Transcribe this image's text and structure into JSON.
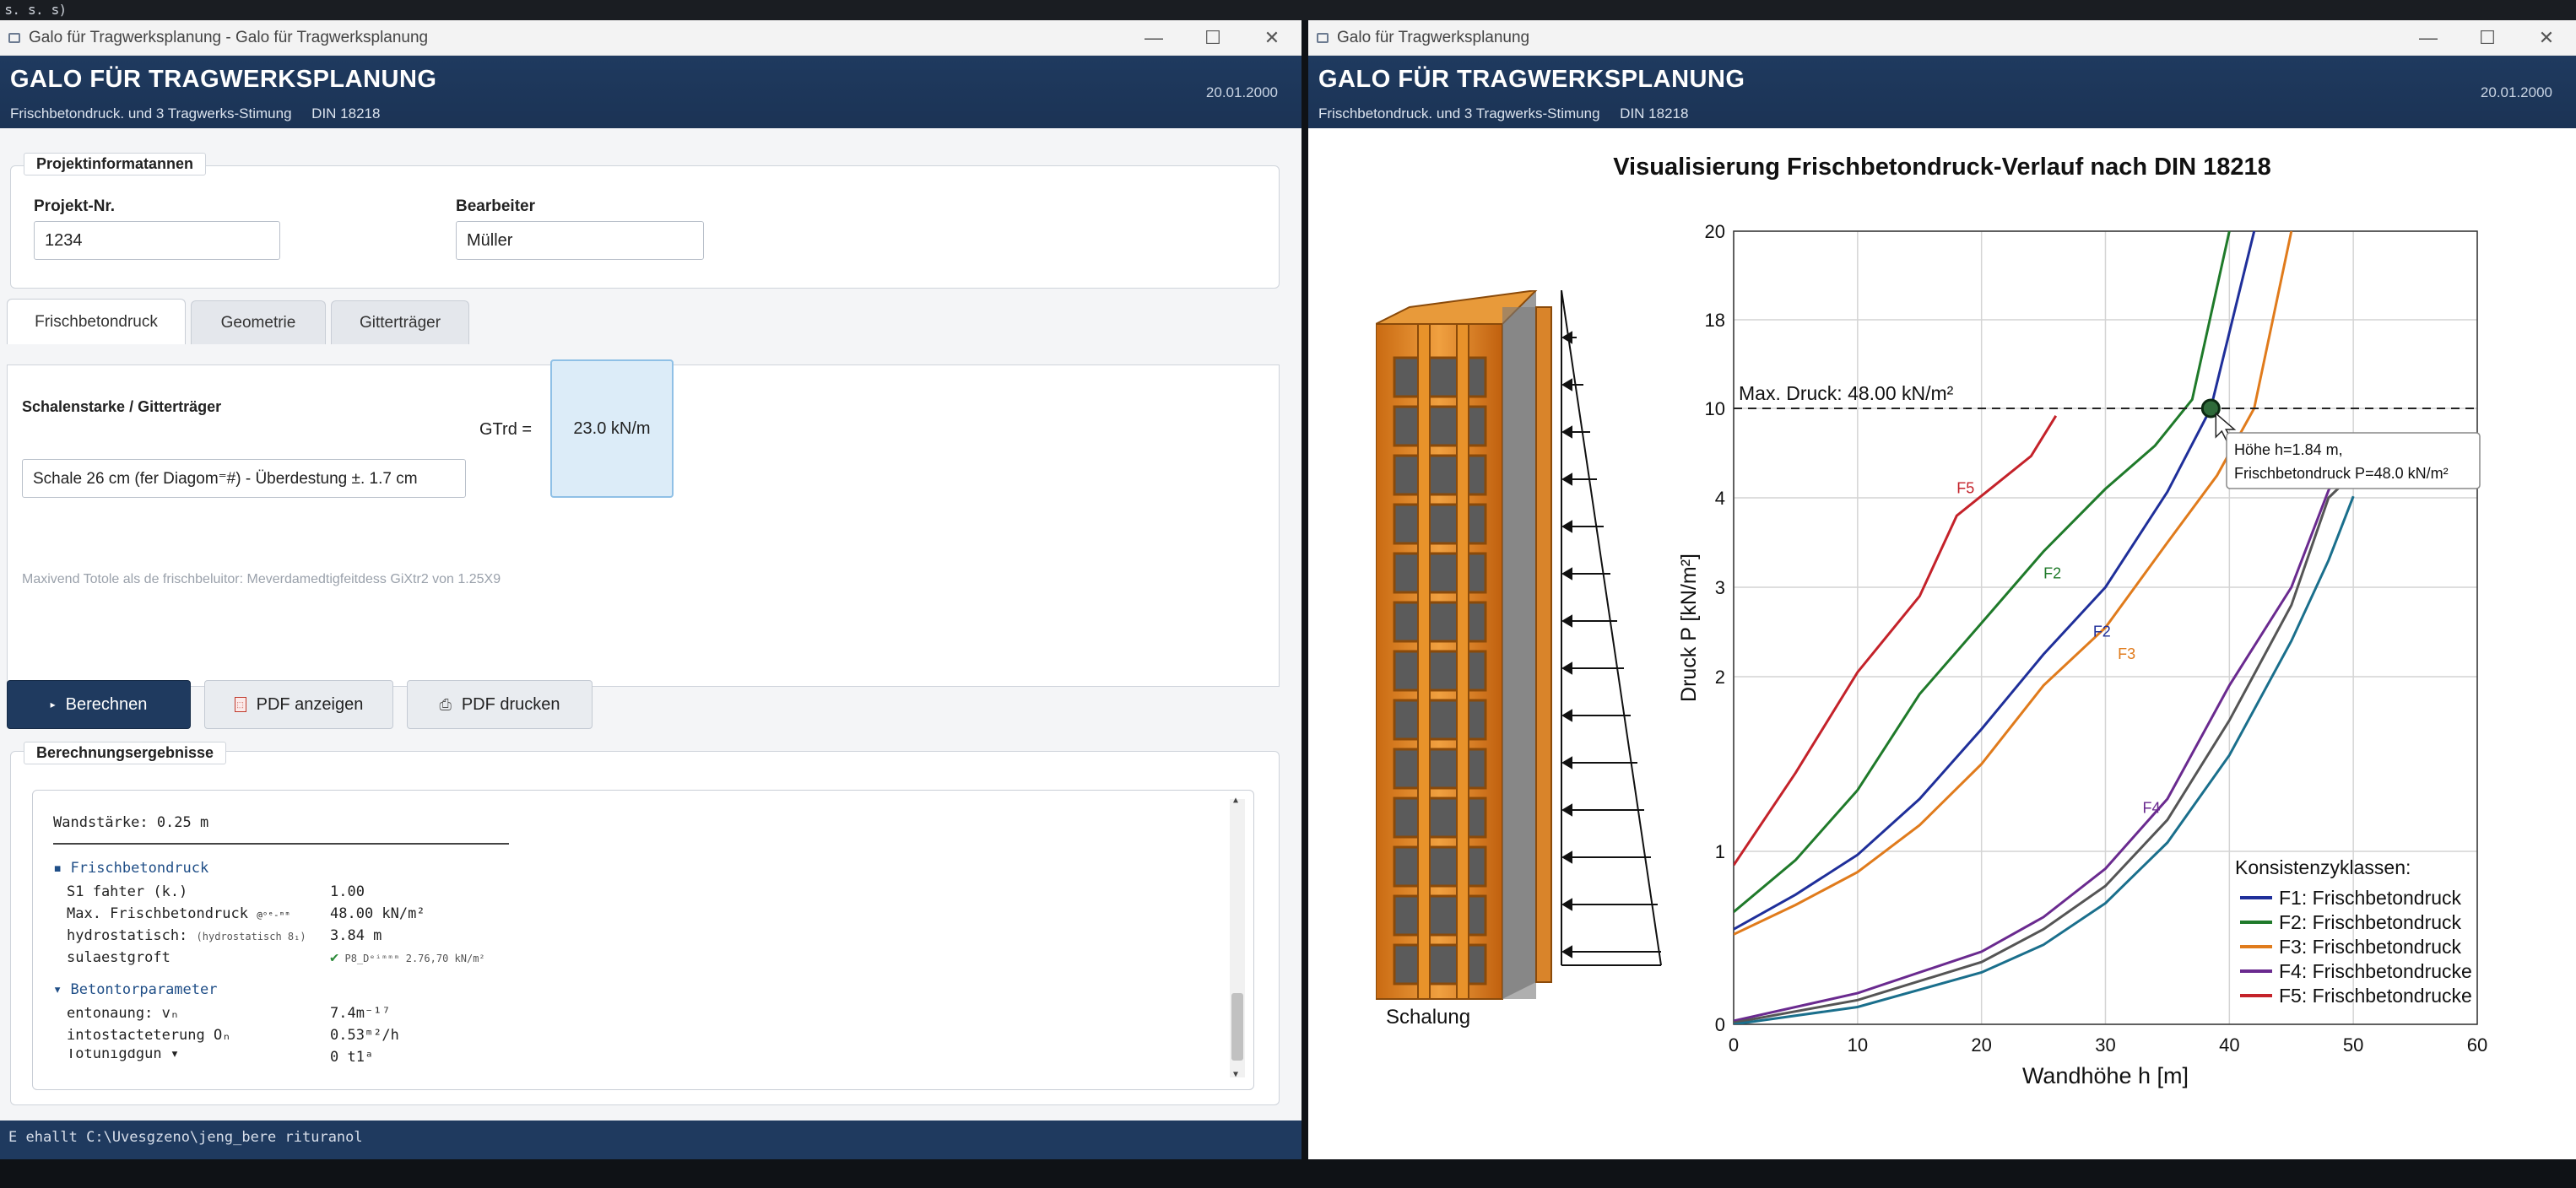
{
  "topstrip": "ꜱ. ꜱ. ꜱ)",
  "left_window": {
    "title": "Galo für Tragwerksplanung - Galo für Tragwerksplanung",
    "header": {
      "title": "GALO FÜR TRAGWERKSPLANUNG",
      "subtitle": "Frischbetondruck. und 3 Tragwerks-Stimung",
      "norm": "DIN 18218",
      "date": "20.01.2000"
    },
    "project": {
      "legend": "Projektinformatannen",
      "nr_label": "Projekt-Nr.",
      "nr_value": "1234",
      "bearbeiter_label": "Bearbeiter",
      "bearbeiter_value": "Müller"
    },
    "tabs": [
      "Frischbetondruck",
      "Geometrie",
      "Gitterträger"
    ],
    "tab_content": {
      "section_label": "Schalenstarke / Gitterträger",
      "select_value": "Schale 26 cm (fer Diagom⁼#) - Überdestung ±. 1.7 cm",
      "gtrd_label": "GTrd =",
      "gtrd_value": "23.0 kN/m",
      "note": "Maxivend Totole als de frischbeluitor: Meverdamedtigfeitdess GiXtr2 von 1.25X9"
    },
    "buttons": {
      "calc": "Berechnen",
      "pdf_show": "PDF anzeigen",
      "pdf_print": "PDF drucken"
    },
    "results": {
      "legend": "Berechnungsergebnisse",
      "wall_line": "Wandstärke: 0.25 m",
      "section1": "Frischbetondruck",
      "rows1": [
        {
          "label": "S1 fahter (k.)",
          "value": "1.00"
        },
        {
          "label": "Max. Frischbetondruck",
          "sub": "@ᵒᵉ-ᵐᵐ",
          "value": "48.00 kN/m²"
        },
        {
          "label": "hydrostatisch:",
          "sub": "(hydrostatisch 8₁)",
          "value": "3.84 m"
        },
        {
          "label": "sulaestgroft",
          "value": "P8_Dᵉⁱᵐᵐᵐ 2.76,70 kN/m²"
        }
      ],
      "section2": "Betontorparameter",
      "rows2": [
        {
          "label": "entonaung: vₙ",
          "value": "7.4m⁻¹⁷"
        },
        {
          "label": "intostacteterung Oₙ",
          "value": "0.53ᵐ²/h"
        },
        {
          "label": "Totunigdgun ▾",
          "value": "0 t1ᵃ"
        }
      ]
    },
    "status": "E ehallt C:\\Uvesgzeno\\jeng_bere rituranol"
  },
  "right_window": {
    "title": "Galo für Tragwerksplanung",
    "header": {
      "title": "GALO FÜR TRAGWERKSPLANUNG",
      "subtitle": "Frischbetondruck. und 3 Tragwerks-Stimung",
      "norm": "DIN 18218",
      "date": "20.01.2000"
    },
    "chart_title": "Visualisierung Frischbetondruck-Verlauf nach DIN 18218",
    "schalung_label": "Schalung"
  },
  "chart_data": {
    "type": "line",
    "title": "Visualisierung Frischbetondruck-Verlauf nach DIN 18218",
    "xlabel": "Wandhöhe h [m]",
    "ylabel": "Druck P [kN/m²]",
    "xlim": [
      0,
      60
    ],
    "x_ticks": [
      0,
      10,
      20,
      30,
      40,
      50,
      60
    ],
    "y_ticks": [
      "0",
      "1",
      "2",
      "3",
      "4",
      "10",
      "18",
      "20"
    ],
    "grid": true,
    "legend_title": "Konsistenzyklassen:",
    "legend_position": "bottom-right",
    "legend": [
      {
        "name": "F1: Frischbetondruck",
        "color": "#1f2f9a"
      },
      {
        "name": "F2: Frischbetondruck",
        "color": "#1f7a2a"
      },
      {
        "name": "F3: Frischbetondruck",
        "color": "#e07b1c"
      },
      {
        "name": "F4: Frischbetondrucke",
        "color": "#6a2a8f"
      },
      {
        "name": "F5: Frischbetondrucke",
        "color": "#c4222a"
      }
    ],
    "series": [
      {
        "name": "F5",
        "color": "#c4222a",
        "points": [
          [
            0,
            0.92
          ],
          [
            5,
            1.45
          ],
          [
            10,
            2.05
          ],
          [
            15,
            2.9
          ],
          [
            18,
            3.8
          ],
          [
            21,
            4.8
          ],
          [
            24,
            6.8
          ],
          [
            26,
            9.5
          ]
        ]
      },
      {
        "name": "F2",
        "color": "#1f7a2a",
        "points": [
          [
            0,
            0.65
          ],
          [
            5,
            0.95
          ],
          [
            10,
            1.35
          ],
          [
            15,
            1.9
          ],
          [
            20,
            2.6
          ],
          [
            25,
            3.4
          ],
          [
            30,
            4.6
          ],
          [
            34,
            7.5
          ],
          [
            37,
            10.8
          ],
          [
            40,
            20
          ]
        ]
      },
      {
        "name": "F2",
        "color": "#1f2f9a",
        "points": [
          [
            0,
            0.55
          ],
          [
            5,
            0.75
          ],
          [
            10,
            0.98
          ],
          [
            15,
            1.3
          ],
          [
            20,
            1.7
          ],
          [
            25,
            2.25
          ],
          [
            30,
            3.0
          ],
          [
            35,
            4.4
          ],
          [
            38.5,
            10
          ],
          [
            42,
            20
          ]
        ]
      },
      {
        "name": "F3",
        "color": "#e07b1c",
        "points": [
          [
            0,
            0.52
          ],
          [
            5,
            0.69
          ],
          [
            10,
            0.88
          ],
          [
            15,
            1.15
          ],
          [
            20,
            1.5
          ],
          [
            25,
            1.95
          ],
          [
            30,
            2.55
          ],
          [
            35,
            3.5
          ],
          [
            39,
            5.5
          ],
          [
            42,
            10
          ],
          [
            45,
            20
          ]
        ]
      },
      {
        "name": "F4",
        "color": "#6a2a8f",
        "points": [
          [
            0,
            0.02
          ],
          [
            10,
            0.18
          ],
          [
            20,
            0.42
          ],
          [
            25,
            0.62
          ],
          [
            30,
            0.9
          ],
          [
            35,
            1.3
          ],
          [
            40,
            1.95
          ],
          [
            45,
            3.0
          ],
          [
            48,
            4.5
          ],
          [
            50,
            7.5
          ]
        ]
      },
      {
        "name": "",
        "color": "#555555",
        "points": [
          [
            0,
            0.01
          ],
          [
            10,
            0.14
          ],
          [
            20,
            0.36
          ],
          [
            25,
            0.55
          ],
          [
            30,
            0.8
          ],
          [
            35,
            1.18
          ],
          [
            40,
            1.75
          ],
          [
            45,
            2.8
          ],
          [
            48,
            4.0
          ],
          [
            50,
            5.6
          ]
        ]
      },
      {
        "name": "",
        "color": "#1a6f8c",
        "points": [
          [
            0,
            0
          ],
          [
            10,
            0.1
          ],
          [
            20,
            0.3
          ],
          [
            25,
            0.46
          ],
          [
            30,
            0.7
          ],
          [
            35,
            1.05
          ],
          [
            40,
            1.55
          ],
          [
            45,
            2.4
          ],
          [
            48,
            3.3
          ],
          [
            50,
            4.1
          ]
        ]
      }
    ],
    "annotations": {
      "max_line_label": "Max. Druck: 48.00 kN/m²",
      "max_line_y": 10,
      "marker": {
        "x": 38.5,
        "y": 10
      },
      "tooltip_line1": "Höhe h=1.84 m,",
      "tooltip_line2": "Frischbetondruck P=48.0 kN/m²",
      "curve_labels": [
        {
          "text": "F5",
          "x": 18,
          "y": 4.3,
          "color": "#c4222a"
        },
        {
          "text": "F2",
          "x": 25,
          "y": 3.1,
          "color": "#1f7a2a"
        },
        {
          "text": "F2",
          "x": 29,
          "y": 2.45,
          "color": "#1f2f9a"
        },
        {
          "text": "F3",
          "x": 31,
          "y": 2.2,
          "color": "#e07b1c"
        },
        {
          "text": "F4",
          "x": 33,
          "y": 1.22,
          "color": "#6a2a8f"
        }
      ]
    }
  }
}
